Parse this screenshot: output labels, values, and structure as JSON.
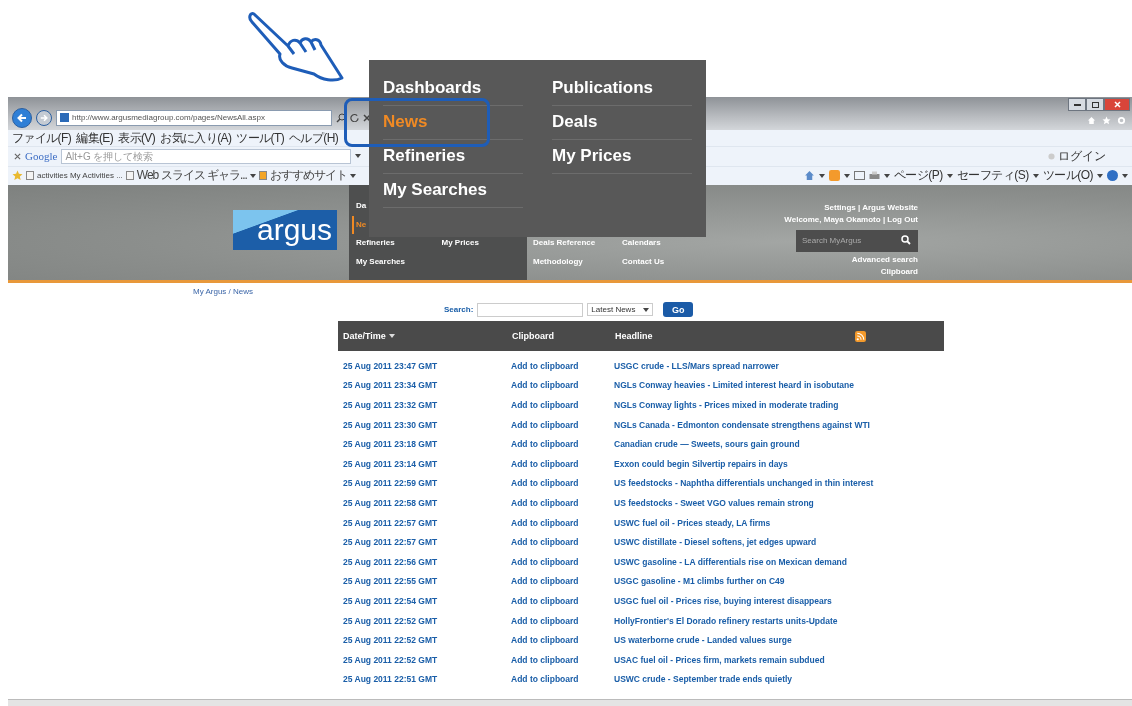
{
  "browser": {
    "address": "http://www.argusmediagroup.com/pages/NewsAll.aspx",
    "menu": [
      "ファイル(F)",
      "編集(E)",
      "表示(V)",
      "お気に入り(A)",
      "ツール(T)",
      "ヘルプ(H)"
    ],
    "google": {
      "logo": "Google",
      "placeholder": "Alt+G を押して検索"
    },
    "login": "ログイン",
    "favorites": [
      "activities My Activities ...",
      "Web スライス ギャラ...",
      "おすすめサイト"
    ],
    "commands": [
      "ページ(P)",
      "セーフティ(S)",
      "ツール(O)"
    ]
  },
  "header": {
    "logo": "argus",
    "nav_columns": [
      [
        {
          "label": "Da",
          "selected": false
        },
        {
          "label": "Ne",
          "selected": true
        },
        {
          "label": "Refineries",
          "selected": false
        },
        {
          "label": "My Searches",
          "selected": false
        }
      ],
      [
        {
          "label": "My Prices",
          "selected": false
        }
      ],
      [
        {
          "label": "Deals Reference",
          "selected": false
        },
        {
          "label": "Methodology",
          "selected": false
        }
      ],
      [
        {
          "label": "Calendars",
          "selected": false
        },
        {
          "label": "Contact Us",
          "selected": false
        }
      ]
    ],
    "account_links": [
      "Settings | Argus Website",
      "Welcome, Maya Okamoto | Log Out"
    ],
    "search": {
      "placeholder": "Search MyArgus"
    },
    "extra_links": [
      "Advanced search",
      "Clipboard"
    ]
  },
  "callout_menu": {
    "columns": [
      [
        {
          "label": "Dashboards",
          "selected": false
        },
        {
          "label": "News",
          "selected": true
        },
        {
          "label": "Refineries",
          "selected": false
        },
        {
          "label": "My Searches",
          "selected": false
        }
      ],
      [
        {
          "label": "Publications",
          "selected": false
        },
        {
          "label": "Deals",
          "selected": false
        },
        {
          "label": "My Prices",
          "selected": false
        }
      ]
    ]
  },
  "breadcrumb": "My Argus / News",
  "news_search": {
    "label": "Search:",
    "filter": "Latest News",
    "button": "Go"
  },
  "table": {
    "columns": [
      {
        "label": "Date/Time",
        "sorted": true
      },
      {
        "label": "Clipboard",
        "sorted": false
      },
      {
        "label": "Headline",
        "sorted": false
      }
    ],
    "rows": [
      {
        "date": "25 Aug 2011 23:47 GMT",
        "action": "Add to clipboard",
        "headline": "USGC crude - LLS/Mars spread narrower"
      },
      {
        "date": "25 Aug 2011 23:34 GMT",
        "action": "Add to clipboard",
        "headline": "NGLs Conway heavies - Limited interest heard in isobutane"
      },
      {
        "date": "25 Aug 2011 23:32 GMT",
        "action": "Add to clipboard",
        "headline": "NGLs Conway lights - Prices mixed in moderate trading"
      },
      {
        "date": "25 Aug 2011 23:30 GMT",
        "action": "Add to clipboard",
        "headline": "NGLs Canada - Edmonton condensate strengthens against WTI"
      },
      {
        "date": "25 Aug 2011 23:18 GMT",
        "action": "Add to clipboard",
        "headline": "Canadian crude — Sweets, sours gain ground"
      },
      {
        "date": "25 Aug 2011 23:14 GMT",
        "action": "Add to clipboard",
        "headline": "Exxon could begin Silvertip repairs in days"
      },
      {
        "date": "25 Aug 2011 22:59 GMT",
        "action": "Add to clipboard",
        "headline": "US feedstocks - Naphtha differentials unchanged in thin interest"
      },
      {
        "date": "25 Aug 2011 22:58 GMT",
        "action": "Add to clipboard",
        "headline": "US feedstocks - Sweet VGO values remain strong"
      },
      {
        "date": "25 Aug 2011 22:57 GMT",
        "action": "Add to clipboard",
        "headline": "USWC fuel oil - Prices steady, LA firms"
      },
      {
        "date": "25 Aug 2011 22:57 GMT",
        "action": "Add to clipboard",
        "headline": "USWC distillate - Diesel softens, jet edges upward"
      },
      {
        "date": "25 Aug 2011 22:56 GMT",
        "action": "Add to clipboard",
        "headline": "USWC gasoline - LA differentials rise on Mexican demand"
      },
      {
        "date": "25 Aug 2011 22:55 GMT",
        "action": "Add to clipboard",
        "headline": "USGC gasoline - M1 climbs further on C49"
      },
      {
        "date": "25 Aug 2011 22:54 GMT",
        "action": "Add to clipboard",
        "headline": "USGC fuel oil - Prices rise, buying interest disappears"
      },
      {
        "date": "25 Aug 2011 22:52 GMT",
        "action": "Add to clipboard",
        "headline": "HollyFrontier's El Dorado refinery restarts units-Update"
      },
      {
        "date": "25 Aug 2011 22:52 GMT",
        "action": "Add to clipboard",
        "headline": "US waterborne crude - Landed values surge"
      },
      {
        "date": "25 Aug 2011 22:52 GMT",
        "action": "Add to clipboard",
        "headline": "USAC fuel oil - Prices firm, markets remain subdued"
      },
      {
        "date": "25 Aug 2011 22:51 GMT",
        "action": "Add to clipboard",
        "headline": "USWC crude - September trade ends quietly"
      }
    ]
  }
}
